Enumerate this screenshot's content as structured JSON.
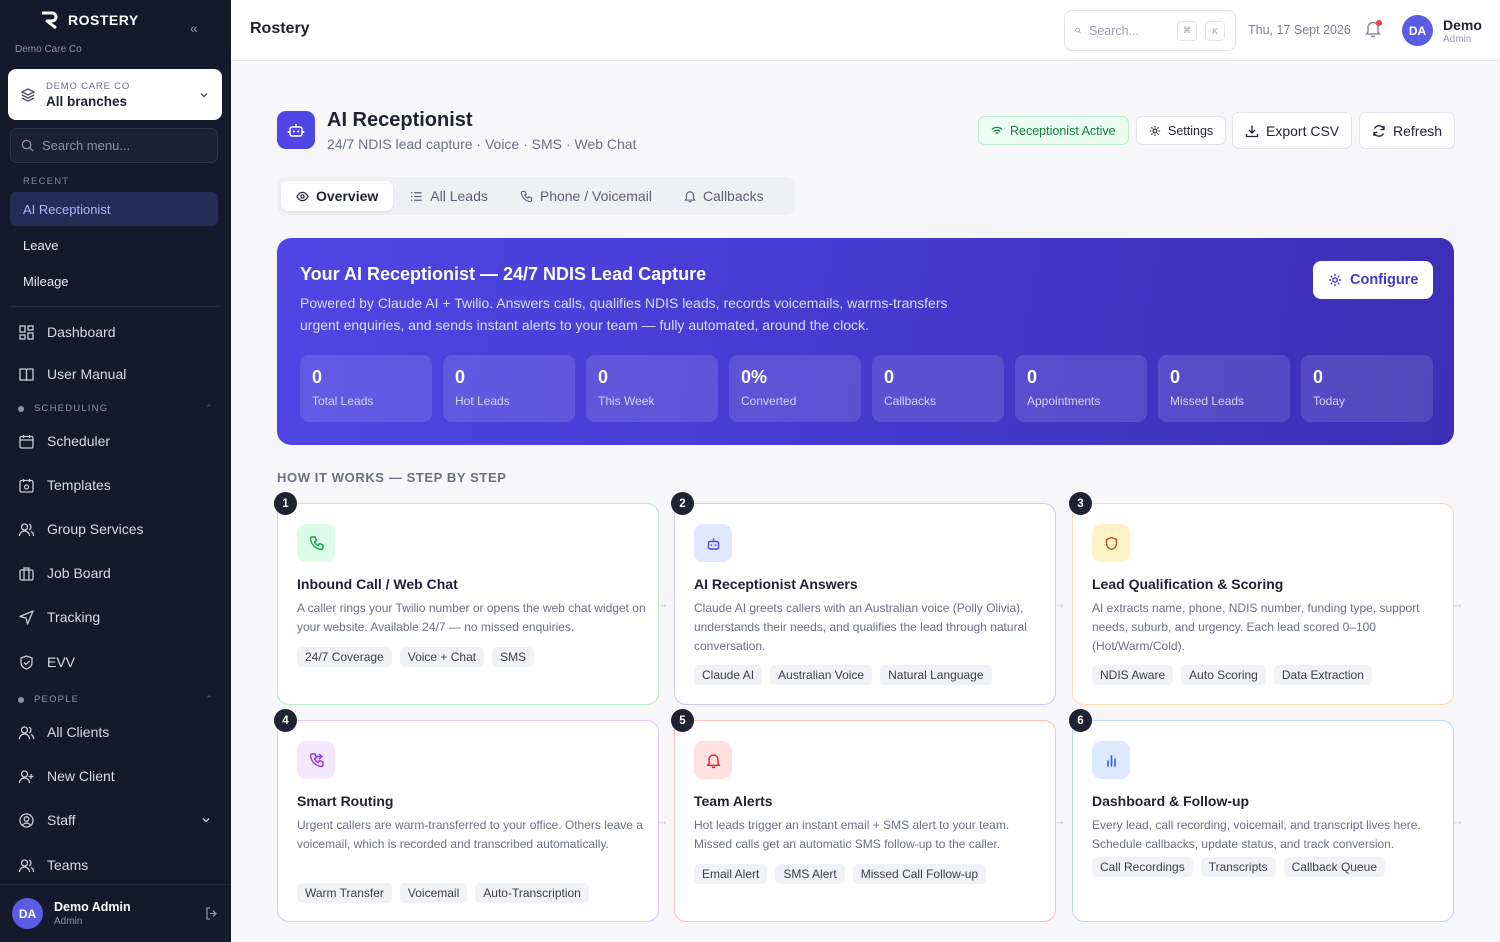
{
  "sidebar": {
    "brand": "ROSTERY",
    "org": "Demo Care Co",
    "branch_label": "DEMO CARE CO",
    "branch_value": "All branches",
    "search_placeholder": "Search menu...",
    "recent_label": "RECENT",
    "recent": [
      "AI Receptionist",
      "Leave",
      "Mileage"
    ],
    "nav_top": [
      "Dashboard",
      "User Manual"
    ],
    "scheduling_label": "SCHEDULING",
    "scheduling": [
      "Scheduler",
      "Templates",
      "Group Services",
      "Job Board",
      "Tracking",
      "EVV"
    ],
    "people_label": "PEOPLE",
    "people": [
      "All Clients",
      "New Client",
      "Staff",
      "Teams"
    ],
    "user": {
      "initials": "DA",
      "name": "Demo Admin",
      "role": "Admin"
    }
  },
  "topbar": {
    "title": "Rostery",
    "search_placeholder": "Search...",
    "kbd": [
      "⌘",
      "K"
    ],
    "date": "Thu, 17 Sept 2026",
    "user": {
      "initials": "DA",
      "name": "Demo",
      "role": "Admin"
    }
  },
  "header": {
    "title": "AI Receptionist",
    "subtitle": "24/7 NDIS lead capture · Voice · SMS · Web Chat",
    "status": "Receptionist Active",
    "settings": "Settings",
    "export": "Export CSV",
    "refresh": "Refresh"
  },
  "tabs": [
    "Overview",
    "All Leads",
    "Phone / Voicemail",
    "Callbacks"
  ],
  "hero": {
    "title": "Your AI Receptionist — 24/7 NDIS Lead Capture",
    "desc": "Powered by Claude AI + Twilio. Answers calls, qualifies NDIS leads, records voicemails, warms-transfers urgent enquiries, and sends instant alerts to your team — fully automated, around the clock.",
    "configure": "Configure",
    "stats": [
      {
        "value": "0",
        "label": "Total Leads"
      },
      {
        "value": "0",
        "label": "Hot Leads"
      },
      {
        "value": "0",
        "label": "This Week"
      },
      {
        "value": "0%",
        "label": "Converted"
      },
      {
        "value": "0",
        "label": "Callbacks"
      },
      {
        "value": "0",
        "label": "Appointments"
      },
      {
        "value": "0",
        "label": "Missed Leads"
      },
      {
        "value": "0",
        "label": "Today"
      }
    ]
  },
  "how_it_works": {
    "title": "HOW IT WORKS — STEP BY STEP",
    "steps": [
      {
        "num": "1",
        "title": "Inbound Call / Web Chat",
        "desc": "A caller rings your Twilio number or opens the web chat widget on your website. Available 24/7 — no missed enquiries.",
        "tags": [
          "24/7 Coverage",
          "Voice + Chat",
          "SMS"
        ],
        "accent": "#22c55e"
      },
      {
        "num": "2",
        "title": "AI Receptionist Answers",
        "desc": "Claude AI greets callers with an Australian voice (Polly Olivia), understands their needs, and qualifies the lead through natural conversation.",
        "tags": [
          "Claude AI",
          "Australian Voice",
          "Natural Language"
        ],
        "accent": "#6366f1"
      },
      {
        "num": "3",
        "title": "Lead Qualification & Scoring",
        "desc": "AI extracts name, phone, NDIS number, funding type, support needs, suburb, and urgency. Each lead scored 0–100 (Hot/Warm/Cold).",
        "tags": [
          "NDIS Aware",
          "Auto Scoring",
          "Data Extraction"
        ],
        "accent": "#f59e0b"
      },
      {
        "num": "4",
        "title": "Smart Routing",
        "desc": "Urgent callers are warm-transferred to your office. Others leave a voicemail, which is recorded and transcribed automatically.",
        "tags": [
          "Warm Transfer",
          "Voicemail",
          "Auto-Transcription"
        ],
        "accent": "#a855f7"
      },
      {
        "num": "5",
        "title": "Team Alerts",
        "desc": "Hot leads trigger an instant email + SMS alert to your team. Missed calls get an automatic SMS follow-up to the caller.",
        "tags": [
          "Email Alert",
          "SMS Alert",
          "Missed Call Follow-up"
        ],
        "accent": "#ef4444"
      },
      {
        "num": "6",
        "title": "Dashboard & Follow-up",
        "desc": "Every lead, call recording, voicemail, and transcript lives here. Schedule callbacks, update status, and track conversion.",
        "tags": [
          "Call Recordings",
          "Transcripts",
          "Callback Queue"
        ],
        "accent": "#3b82f6"
      }
    ]
  }
}
